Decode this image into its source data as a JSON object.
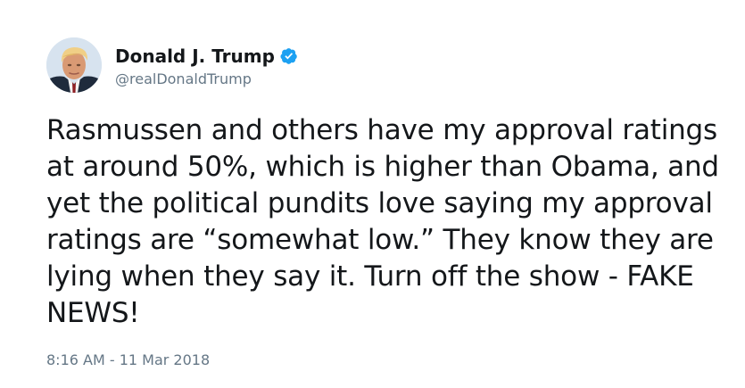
{
  "tweet": {
    "author": {
      "display_name": "Donald J. Trump",
      "handle": "@realDonaldTrump",
      "verified": true,
      "avatar_icon": "profile-photo-avatar"
    },
    "text": "Rasmussen and others have my approval ratings at around 50%, which is higher than Obama, and yet the political pundits love saying my approval ratings are “somewhat low.” They know they are lying when they say it. Turn off the show - FAKE NEWS!",
    "timestamp": "8:16 AM - 11 Mar 2018"
  },
  "colors": {
    "text_primary": "#14171a",
    "text_secondary": "#657786",
    "verified_badge": "#1da1f2",
    "background": "#ffffff"
  }
}
